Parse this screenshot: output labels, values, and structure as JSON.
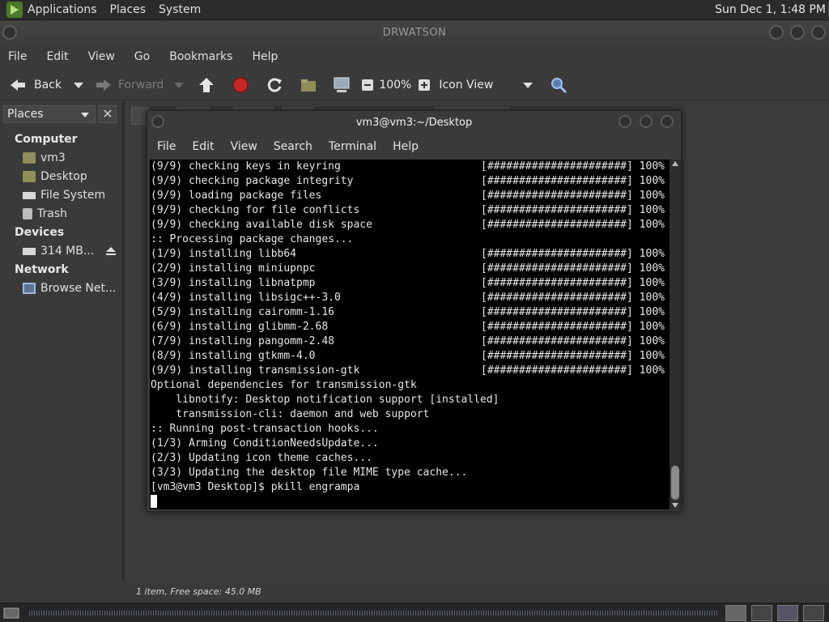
{
  "top_panel": {
    "menus": [
      "Applications",
      "Places",
      "System"
    ],
    "clock": "Sun Dec 1, 1:48 PM"
  },
  "file_manager": {
    "title": "DRWATSON",
    "menus": [
      "File",
      "Edit",
      "View",
      "Go",
      "Bookmarks",
      "Help"
    ],
    "toolbar": {
      "back": "Back",
      "forward": "Forward",
      "zoom": "100%",
      "view_mode": "Icon View"
    },
    "sidebar": {
      "selector": "Places",
      "sections": {
        "computer": "Computer",
        "devices": "Devices",
        "network": "Network"
      },
      "computer_items": [
        "vm3",
        "Desktop",
        "File System",
        "Trash"
      ],
      "device_item": "314 MB...",
      "network_item": "Browse Net..."
    },
    "status": "1 item, Free space: 45.0 MB"
  },
  "terminal": {
    "title": "vm3@vm3:~/Desktop",
    "menus": [
      "File",
      "Edit",
      "View",
      "Search",
      "Terminal",
      "Help"
    ],
    "lines": [
      {
        "text": "(9/9) checking keys in keyring",
        "bar": "[######################] 100%"
      },
      {
        "text": "(9/9) checking package integrity",
        "bar": "[######################] 100%"
      },
      {
        "text": "(9/9) loading package files",
        "bar": "[######################] 100%"
      },
      {
        "text": "(9/9) checking for file conflicts",
        "bar": "[######################] 100%"
      },
      {
        "text": "(9/9) checking available disk space",
        "bar": "[######################] 100%"
      },
      {
        "text": ":: Processing package changes..."
      },
      {
        "text": "(1/9) installing libb64",
        "bar": "[######################] 100%"
      },
      {
        "text": "(2/9) installing miniupnpc",
        "bar": "[######################] 100%"
      },
      {
        "text": "(3/9) installing libnatpmp",
        "bar": "[######################] 100%"
      },
      {
        "text": "(4/9) installing libsigc++-3.0",
        "bar": "[######################] 100%"
      },
      {
        "text": "(5/9) installing cairomm-1.16",
        "bar": "[######################] 100%"
      },
      {
        "text": "(6/9) installing glibmm-2.68",
        "bar": "[######################] 100%"
      },
      {
        "text": "(7/9) installing pangomm-2.48",
        "bar": "[######################] 100%"
      },
      {
        "text": "(8/9) installing gtkmm-4.0",
        "bar": "[######################] 100%"
      },
      {
        "text": "(9/9) installing transmission-gtk",
        "bar": "[######################] 100%"
      },
      {
        "text": "Optional dependencies for transmission-gtk"
      },
      {
        "text": "    libnotify: Desktop notification support [installed]"
      },
      {
        "text": "    transmission-cli: daemon and web support"
      },
      {
        "text": ":: Running post-transaction hooks..."
      },
      {
        "text": "(1/3) Arming ConditionNeedsUpdate..."
      },
      {
        "text": "(2/3) Updating icon theme caches..."
      },
      {
        "text": "(3/3) Updating the desktop file MIME type cache..."
      },
      {
        "text": "[vm3@vm3 Desktop]$ pkill engrampa"
      }
    ]
  }
}
